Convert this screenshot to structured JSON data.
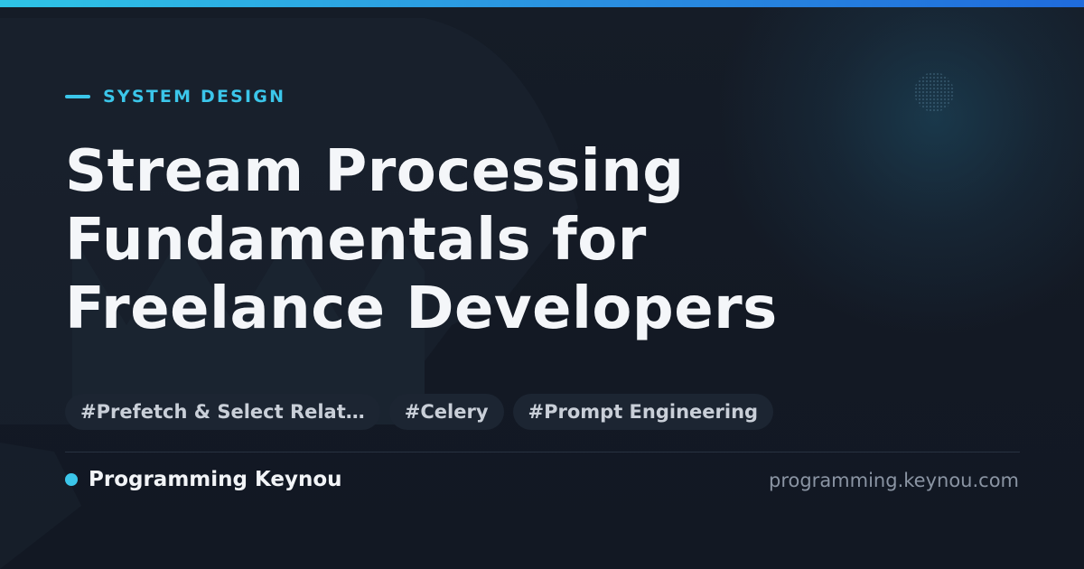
{
  "header": {
    "category": "SYSTEM DESIGN",
    "title_lines": [
      "Stream Processing",
      "Fundamentals for",
      "Freelance Developers"
    ]
  },
  "tags": [
    "#Prefetch & Select Relat…",
    "#Celery",
    "#Prompt Engineering"
  ],
  "footer": {
    "brand_name": "Programming Keynou",
    "site_url": "programming.keynou.com"
  },
  "colors": {
    "accent": "#3bc6ea",
    "background": "#131924",
    "tag_background": "#1c2532",
    "title": "#f4f6f9",
    "muted": "#8a94a3"
  }
}
